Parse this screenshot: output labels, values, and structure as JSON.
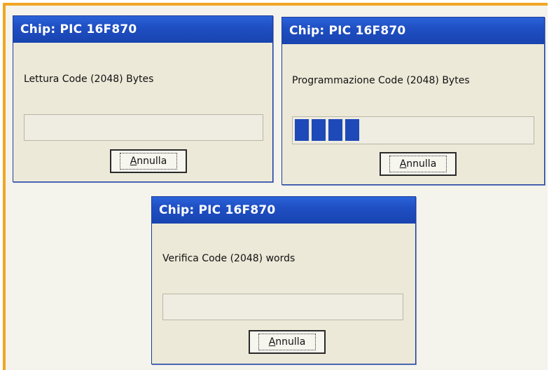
{
  "dialogs": [
    {
      "title": "Chip: PIC 16F870",
      "message": "Lettura Code (2048) Bytes",
      "button_first": "A",
      "button_rest": "nnulla",
      "progress": 0
    },
    {
      "title": "Chip: PIC 16F870",
      "message": "Programmazione Code (2048) Bytes",
      "button_first": "A",
      "button_rest": "nnulla",
      "progress": 0.3,
      "progress_segments": 4
    },
    {
      "title": "Chip: PIC 16F870",
      "message": "Verifica Code (2048) words",
      "button_first": "A",
      "button_rest": "nnulla",
      "progress": 0
    }
  ],
  "colors": {
    "border_accent": "#f2a623",
    "titlebar": "#1f4fc3",
    "progress_fill": "#1e49b8"
  }
}
